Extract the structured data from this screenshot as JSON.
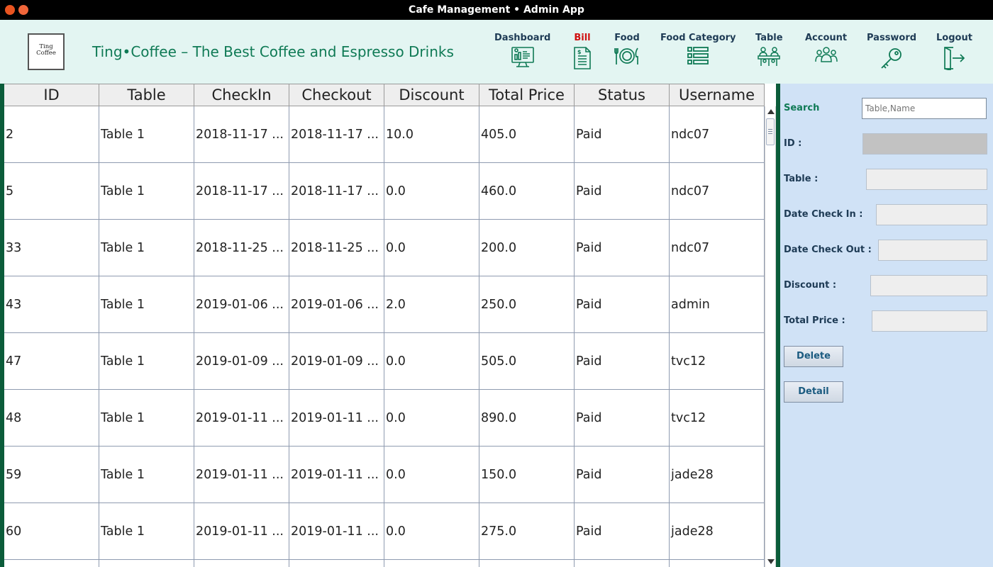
{
  "window": {
    "title": "Cafe Management • Admin App"
  },
  "header": {
    "logo_text": "Ting\nCoffee",
    "slogan": "Ting•Coffee – The Best Coffee and Espresso Drinks",
    "nav": [
      {
        "label": "Dashboard",
        "icon": "dashboard-icon",
        "active": false
      },
      {
        "label": "Bill",
        "icon": "bill-icon",
        "active": true
      },
      {
        "label": "Food",
        "icon": "food-icon",
        "active": false
      },
      {
        "label": "Food Category",
        "icon": "list-icon",
        "active": false
      },
      {
        "label": "Table",
        "icon": "table-icon",
        "active": false
      },
      {
        "label": "Account",
        "icon": "account-icon",
        "active": false
      },
      {
        "label": "Password",
        "icon": "key-icon",
        "active": false
      },
      {
        "label": "Logout",
        "icon": "logout-icon",
        "active": false
      }
    ],
    "accent_color": "#0f7a55",
    "active_color": "#d01010"
  },
  "table": {
    "columns": [
      "ID",
      "Table",
      "CheckIn",
      "Checkout",
      "Discount",
      "Total Price",
      "Status",
      "Username"
    ],
    "rows": [
      [
        "2",
        "Table 1",
        "2018-11-17 ...",
        "2018-11-17 ...",
        "10.0",
        "405.0",
        "Paid",
        "ndc07"
      ],
      [
        "5",
        "Table 1",
        "2018-11-17 ...",
        "2018-11-17 ...",
        "0.0",
        "460.0",
        "Paid",
        "ndc07"
      ],
      [
        "33",
        "Table 1",
        "2018-11-25 ...",
        "2018-11-25 ...",
        "0.0",
        "200.0",
        "Paid",
        "ndc07"
      ],
      [
        "43",
        "Table 1",
        "2019-01-06 ...",
        "2019-01-06 ...",
        "2.0",
        "250.0",
        "Paid",
        "admin"
      ],
      [
        "47",
        "Table 1",
        "2019-01-09 ...",
        "2019-01-09 ...",
        "0.0",
        "505.0",
        "Paid",
        "tvc12"
      ],
      [
        "48",
        "Table 1",
        "2019-01-11 ...",
        "2019-01-11 ...",
        "0.0",
        "890.0",
        "Paid",
        "tvc12"
      ],
      [
        "59",
        "Table 1",
        "2019-01-11 ...",
        "2019-01-11 ...",
        "0.0",
        "150.0",
        "Paid",
        "jade28"
      ],
      [
        "60",
        "Table 1",
        "2019-01-11 ...",
        "2019-01-11 ...",
        "0.0",
        "275.0",
        "Paid",
        "jade28"
      ]
    ]
  },
  "panel": {
    "search_label": "Search",
    "search_placeholder": "Table,Name",
    "id_label": "ID :",
    "table_label": "Table :",
    "checkin_label": "Date Check In :",
    "checkout_label": "Date Check Out :",
    "discount_label": "Discount :",
    "total_label": "Total Price :",
    "delete_label": "Delete",
    "detail_label": "Detail"
  }
}
